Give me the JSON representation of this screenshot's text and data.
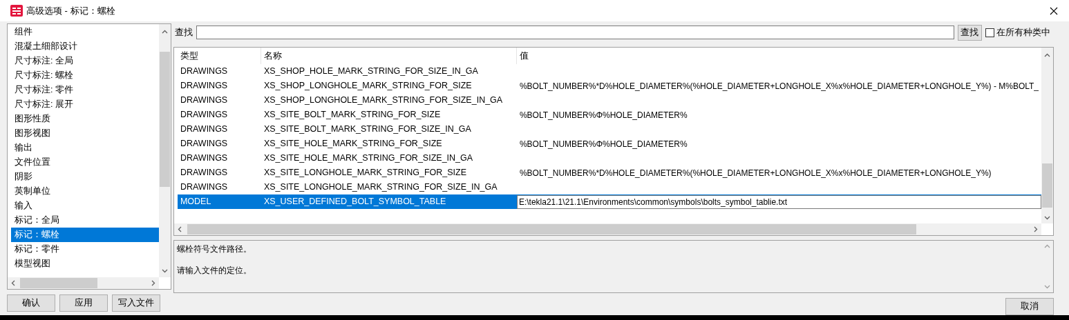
{
  "window": {
    "title": "高级选项 - 标记：螺栓"
  },
  "categories": [
    {
      "label": "组件",
      "selected": false
    },
    {
      "label": "混凝土细部设计",
      "selected": false
    },
    {
      "label": "尺寸标注: 全局",
      "selected": false
    },
    {
      "label": "尺寸标注: 螺栓",
      "selected": false
    },
    {
      "label": "尺寸标注: 零件",
      "selected": false
    },
    {
      "label": "尺寸标注: 展开",
      "selected": false
    },
    {
      "label": "图形性质",
      "selected": false
    },
    {
      "label": "图形视图",
      "selected": false
    },
    {
      "label": "输出",
      "selected": false
    },
    {
      "label": "文件位置",
      "selected": false
    },
    {
      "label": "阴影",
      "selected": false
    },
    {
      "label": "英制单位",
      "selected": false
    },
    {
      "label": "输入",
      "selected": false
    },
    {
      "label": "标记：全局",
      "selected": false
    },
    {
      "label": "标记：螺栓",
      "selected": true
    },
    {
      "label": "标记：零件",
      "selected": false
    },
    {
      "label": "模型视图",
      "selected": false
    }
  ],
  "search": {
    "label": "查找",
    "button": "查找",
    "all_categories": {
      "label": "在所有种类中",
      "checked": false
    }
  },
  "table": {
    "columns": [
      "类型",
      "名称",
      "值"
    ],
    "rows": [
      {
        "type": "DRAWINGS",
        "name": "XS_SHOP_HOLE_MARK_STRING_FOR_SIZE_IN_GA",
        "selected": false
      },
      {
        "type": "DRAWINGS",
        "name": "XS_SHOP_LONGHOLE_MARK_STRING_FOR_SIZE",
        "value": "%BOLT_NUMBER%*D%HOLE_DIAMETER%(%HOLE_DIAMETER+LONGHOLE_X%x%HOLE_DIAMETER+LONGHOLE_Y%) - M%BOLT_",
        "selected": false
      },
      {
        "type": "DRAWINGS",
        "name": "XS_SHOP_LONGHOLE_MARK_STRING_FOR_SIZE_IN_GA",
        "selected": false
      },
      {
        "type": "DRAWINGS",
        "name": "XS_SITE_BOLT_MARK_STRING_FOR_SIZE",
        "value": "%BOLT_NUMBER%Φ%HOLE_DIAMETER%",
        "selected": false
      },
      {
        "type": "DRAWINGS",
        "name": "XS_SITE_BOLT_MARK_STRING_FOR_SIZE_IN_GA",
        "selected": false
      },
      {
        "type": "DRAWINGS",
        "name": "XS_SITE_HOLE_MARK_STRING_FOR_SIZE",
        "value": "%BOLT_NUMBER%Φ%HOLE_DIAMETER%",
        "selected": false
      },
      {
        "type": "DRAWINGS",
        "name": "XS_SITE_HOLE_MARK_STRING_FOR_SIZE_IN_GA",
        "selected": false
      },
      {
        "type": "DRAWINGS",
        "name": "XS_SITE_LONGHOLE_MARK_STRING_FOR_SIZE",
        "value": "%BOLT_NUMBER%*D%HOLE_DIAMETER%(%HOLE_DIAMETER+LONGHOLE_X%x%HOLE_DIAMETER+LONGHOLE_Y%)",
        "selected": false
      },
      {
        "type": "DRAWINGS",
        "name": "XS_SITE_LONGHOLE_MARK_STRING_FOR_SIZE_IN_GA",
        "selected": false
      },
      {
        "type": "MODEL",
        "name": "XS_USER_DEFINED_BOLT_SYMBOL_TABLE",
        "value": "E:\\tekla21.1\\21.1\\Environments\\common\\symbols\\bolts_symbol_tablie.txt",
        "selected": true
      }
    ]
  },
  "description": [
    "螺栓符号文件路径。",
    "请输入文件的定位。"
  ],
  "buttons": {
    "ok": "确认",
    "apply": "应用",
    "save": "写入文件",
    "cancel": "取消"
  }
}
